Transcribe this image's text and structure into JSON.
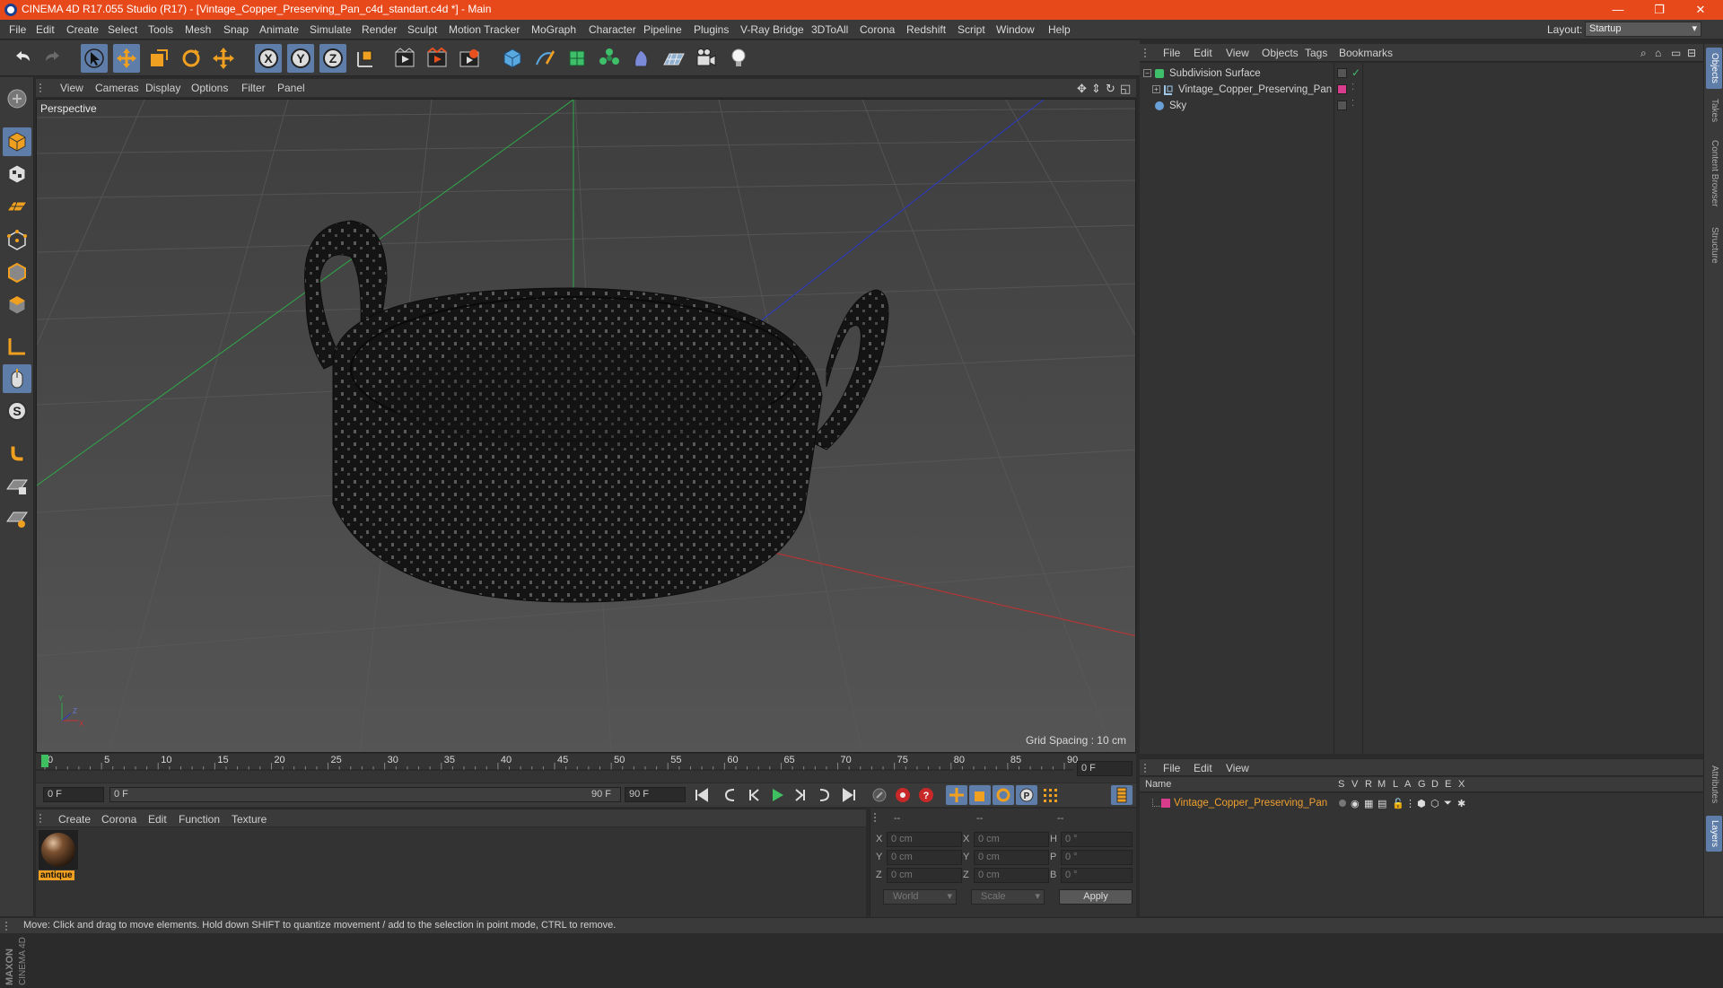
{
  "window": {
    "title": "CINEMA 4D R17.055 Studio (R17) - [Vintage_Copper_Preserving_Pan_c4d_standart.c4d *] - Main",
    "minimize": "—",
    "restore": "❐",
    "close": "✕"
  },
  "menubar": {
    "items": [
      "File",
      "Edit",
      "Create",
      "Select",
      "Tools",
      "Mesh",
      "Snap",
      "Animate",
      "Simulate",
      "Render",
      "Sculpt",
      "Motion Tracker",
      "MoGraph",
      "Character",
      "Pipeline",
      "Plugins",
      "V-Ray Bridge",
      "3DToAll",
      "Corona",
      "Redshift",
      "Script",
      "Window",
      "Help"
    ],
    "layout_label": "Layout:",
    "layout_value": "Startup"
  },
  "toolbar": {
    "icons": [
      "undo-icon",
      "redo-icon",
      "select-icon",
      "move-icon",
      "scale-icon",
      "rotate-icon",
      "transform-icon",
      "x-axis-icon",
      "y-axis-icon",
      "z-axis-icon",
      "coord-system-icon",
      "render-view-icon",
      "render-picture-viewer-icon",
      "render-settings-icon",
      "cube-icon",
      "pen-icon",
      "subdivision-icon",
      "mograph-icon",
      "deformer-icon",
      "floor-icon",
      "camera-icon",
      "light-icon"
    ]
  },
  "viewport": {
    "menu": [
      "View",
      "Cameras",
      "Display",
      "Options",
      "Filter",
      "Panel"
    ],
    "label": "Perspective",
    "grid_spacing": "Grid Spacing : 10 cm"
  },
  "timeline": {
    "ticks": [
      "0",
      "5",
      "10",
      "15",
      "20",
      "25",
      "30",
      "35",
      "40",
      "45",
      "50",
      "55",
      "60",
      "65",
      "70",
      "75",
      "80",
      "85",
      "90"
    ],
    "current_frame": "0 F",
    "start_field": "0 F",
    "range_start": "0 F",
    "range_end": "90 F",
    "end_field": "90 F"
  },
  "material_manager": {
    "menu": [
      "Create",
      "Corona",
      "Edit",
      "Function",
      "Texture"
    ],
    "materials": [
      {
        "name": "antique"
      }
    ]
  },
  "coordinates": {
    "header": [
      "--",
      "--",
      "--"
    ],
    "rows": [
      {
        "a": "X",
        "a_val": "0 cm",
        "b": "X",
        "b_val": "0 cm",
        "c": "H",
        "c_val": "0 °"
      },
      {
        "a": "Y",
        "a_val": "0 cm",
        "b": "Y",
        "b_val": "0 cm",
        "c": "P",
        "c_val": "0 °"
      },
      {
        "a": "Z",
        "a_val": "0 cm",
        "b": "Z",
        "b_val": "0 cm",
        "c": "B",
        "c_val": "0 °"
      }
    ],
    "mode1": "World",
    "mode2": "Scale",
    "apply": "Apply"
  },
  "object_manager": {
    "menu": [
      "File",
      "Edit",
      "View",
      "Objects",
      "Tags",
      "Bookmarks"
    ],
    "objects": [
      {
        "name": "Subdivision Surface",
        "icon_color": "#3fbf6a"
      },
      {
        "name": "Vintage_Copper_Preserving_Pan",
        "icon_color": "#9fc8e8",
        "tag_color": "#d83c8c"
      },
      {
        "name": "Sky",
        "icon_color": "#6aa0d8"
      }
    ]
  },
  "layer_manager": {
    "menu": [
      "File",
      "Edit",
      "View"
    ],
    "columns": [
      "Name",
      "S",
      "V",
      "R",
      "M",
      "L",
      "A",
      "G",
      "D",
      "E",
      "X"
    ],
    "layers": [
      {
        "name": "Vintage_Copper_Preserving_Pan",
        "color": "#d83c8c"
      }
    ]
  },
  "right_tabs": [
    "Objects",
    "Takes",
    "Content Browser",
    "Structure",
    "Attributes",
    "Layers"
  ],
  "status": "Move: Click and drag to move elements. Hold down SHIFT to quantize movement / add to the selection in point mode, CTRL to remove.",
  "colors": {
    "title_bar": "#e8491b",
    "accent": "#5e7da8",
    "highlight_text": "#f0a030"
  },
  "branding": {
    "logo_text_1": "MAXON",
    "logo_text_2": "CINEMA 4D"
  }
}
